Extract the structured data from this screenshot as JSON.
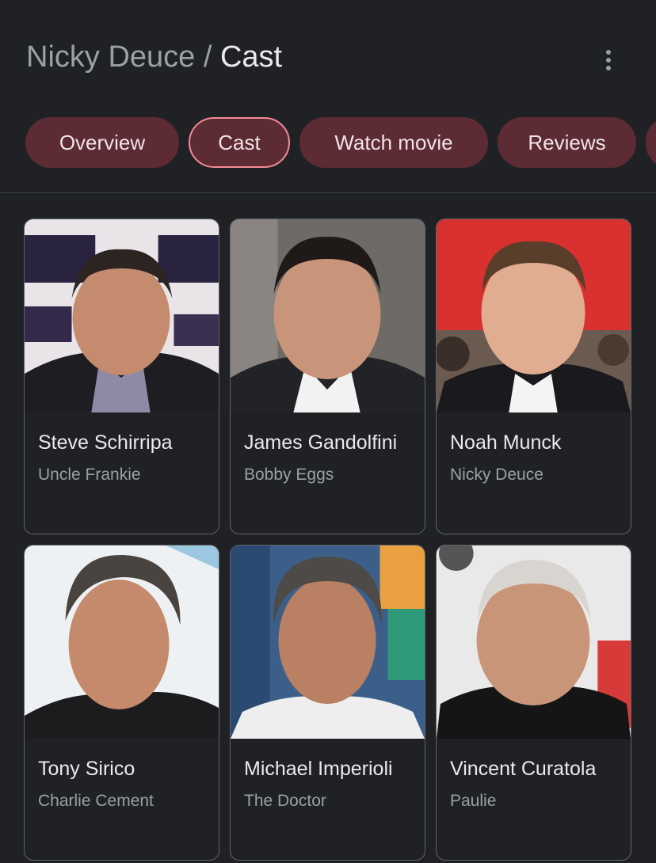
{
  "header": {
    "parent": "Nicky Deuce",
    "separator": " / ",
    "current": "Cast"
  },
  "tabs": [
    {
      "label": "Overview",
      "active": false
    },
    {
      "label": "Cast",
      "active": true
    },
    {
      "label": "Watch movie",
      "active": false
    },
    {
      "label": "Reviews",
      "active": false
    }
  ],
  "cast": [
    {
      "name": "Steve Schirripa",
      "role": "Uncle Frankie"
    },
    {
      "name": "James Gandolfini",
      "role": "Bobby Eggs"
    },
    {
      "name": "Noah Munck",
      "role": "Nicky Deuce"
    },
    {
      "name": "Tony Sirico",
      "role": "Charlie Cement"
    },
    {
      "name": "Michael Imperioli",
      "role": "The Doctor"
    },
    {
      "name": "Vincent Curatola",
      "role": "Paulie"
    }
  ],
  "colors": {
    "background": "#202124",
    "tab_fill": "#5c2b34",
    "tab_active_border": "#f28b95",
    "card_border": "#5f6368"
  }
}
